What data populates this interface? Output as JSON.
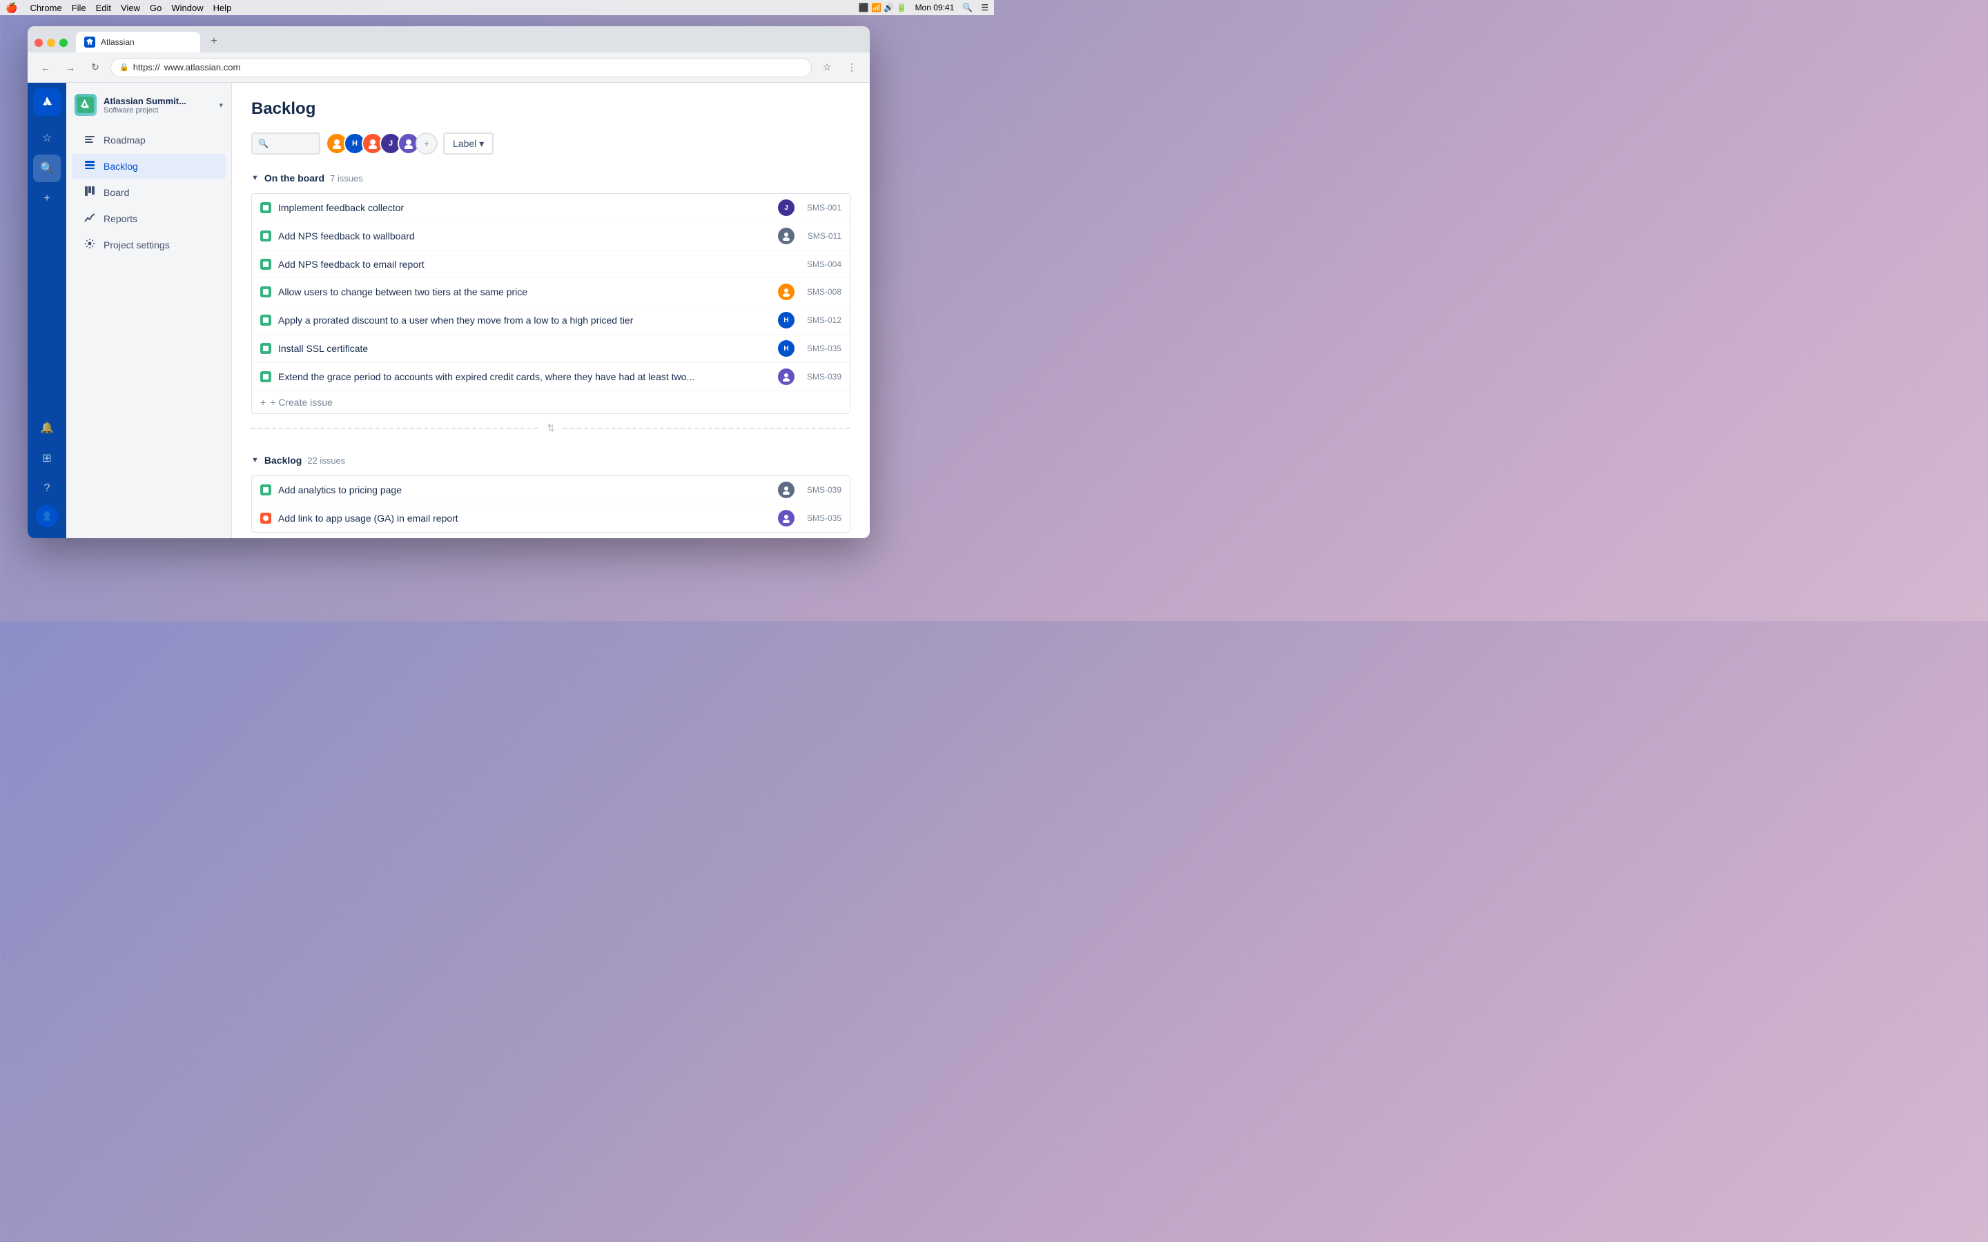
{
  "menubar": {
    "apple": "🍎",
    "app": "Chrome",
    "menus": [
      "Chrome",
      "File",
      "Edit",
      "View",
      "Go",
      "Window",
      "Help"
    ],
    "time": "Mon 09:41"
  },
  "browser": {
    "tab_title": "Atlassian",
    "url_protocol": "https://",
    "url_domain": "www.atlassian.com"
  },
  "project": {
    "name": "Atlassian Summit...",
    "type": "Software project"
  },
  "nav": {
    "items": [
      {
        "id": "roadmap",
        "label": "Roadmap",
        "icon": "📈"
      },
      {
        "id": "backlog",
        "label": "Backlog",
        "icon": "☰",
        "active": true
      },
      {
        "id": "board",
        "label": "Board",
        "icon": "⊞"
      },
      {
        "id": "reports",
        "label": "Reports",
        "icon": "📊"
      },
      {
        "id": "settings",
        "label": "Project settings",
        "icon": "⚙"
      }
    ]
  },
  "page": {
    "title": "Backlog",
    "label_btn": "Label"
  },
  "avatars": [
    {
      "color": "#ff8b00",
      "initials": ""
    },
    {
      "color": "#0052cc",
      "initials": "H"
    },
    {
      "color": "#ff5630",
      "initials": ""
    },
    {
      "color": "#403294",
      "initials": "J"
    },
    {
      "color": "#6554c0",
      "initials": ""
    }
  ],
  "on_the_board": {
    "title": "On the board",
    "count": "7 issues",
    "issues": [
      {
        "id": "SMS-001",
        "title": "Implement feedback collector",
        "type": "story",
        "avatar_color": "#403294",
        "avatar_initials": "J"
      },
      {
        "id": "SMS-011",
        "title": "Add NPS feedback to wallboard",
        "type": "story",
        "avatar_color": "#5e6c84",
        "avatar_initials": ""
      },
      {
        "id": "SMS-004",
        "title": "Add NPS feedback to email report",
        "type": "story",
        "avatar_color": null,
        "avatar_initials": ""
      },
      {
        "id": "SMS-008",
        "title": "Allow users to change between two tiers at the same price",
        "type": "story",
        "avatar_color": "#ff8b00",
        "avatar_initials": ""
      },
      {
        "id": "SMS-012",
        "title": "Apply a prorated discount to a user when they move from a low to a high priced tier",
        "type": "story",
        "avatar_color": "#0052cc",
        "avatar_initials": "H"
      },
      {
        "id": "SMS-035",
        "title": "Install SSL certificate",
        "type": "story",
        "avatar_color": "#0052cc",
        "avatar_initials": "H"
      },
      {
        "id": "SMS-039",
        "title": "Extend the grace period to accounts with expired credit cards, where they have had at least two...",
        "type": "story",
        "avatar_color": "#6554c0",
        "avatar_initials": ""
      }
    ],
    "create_issue_label": "+ Create issue"
  },
  "backlog_section": {
    "title": "Backlog",
    "count": "22 issues",
    "issues": [
      {
        "id": "SMS-039",
        "title": "Add analytics to pricing page",
        "type": "story",
        "avatar_color": "#5e6c84",
        "avatar_initials": ""
      },
      {
        "id": "SMS-035",
        "title": "Add link to app usage (GA) in email report",
        "type": "bug",
        "avatar_color": "#6554c0",
        "avatar_initials": ""
      }
    ]
  }
}
